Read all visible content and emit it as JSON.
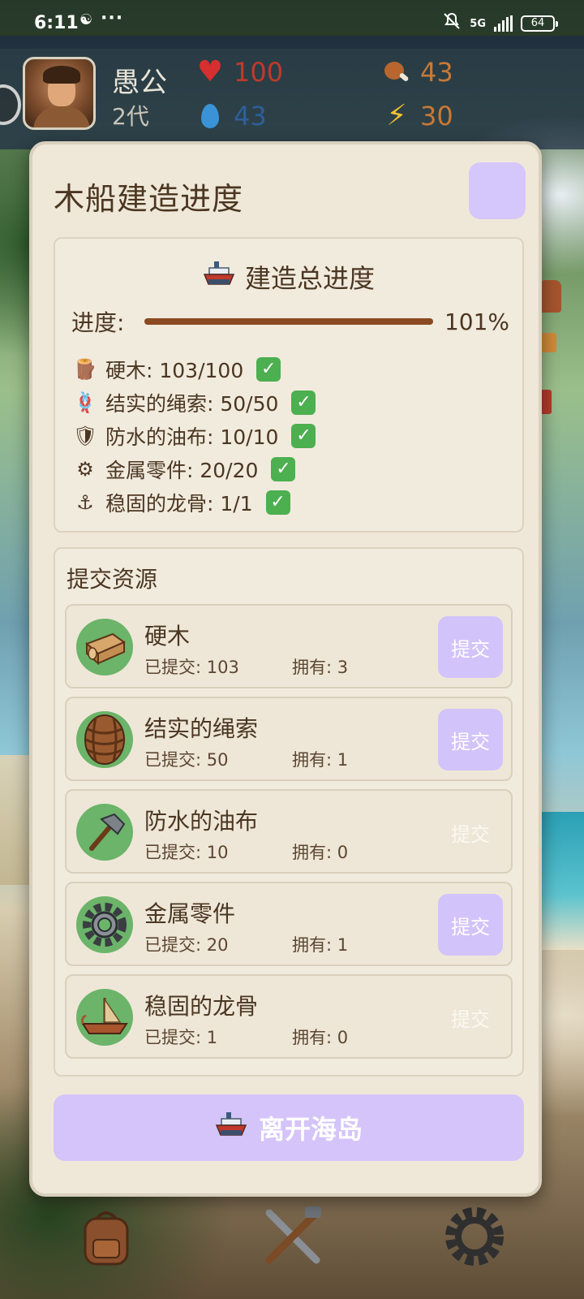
{
  "status_bar": {
    "time": "6:11",
    "notif_icon": "☯",
    "more": "···",
    "network": "5G",
    "battery": "64"
  },
  "player": {
    "name": "愚公",
    "generation": "2代",
    "hp": "100",
    "water": "43",
    "food": "43",
    "energy": "30"
  },
  "modal": {
    "title": "木船建造进度",
    "overall": {
      "title": "建造总进度",
      "label": "进度:",
      "percent_text": "101%",
      "fill_fraction": 1.0
    },
    "requirements": [
      {
        "icon": "log-icon",
        "glyph": "🪵",
        "text": "硬木: 103/100"
      },
      {
        "icon": "rope-icon",
        "glyph": "🪢",
        "text": "结实的绳索: 50/50"
      },
      {
        "icon": "shield-icon",
        "glyph": "🛡",
        "text": "防水的油布: 10/10"
      },
      {
        "icon": "gear-icon",
        "glyph": "⚙",
        "text": "金属零件: 20/20"
      },
      {
        "icon": "anchor-icon",
        "glyph": "⚓",
        "text": "稳固的龙骨: 1/1"
      }
    ],
    "submit_section": {
      "title": "提交资源",
      "items": [
        {
          "name": "硬木",
          "submitted": "已提交: 103",
          "owned": "拥有: 3",
          "button": "提交",
          "enabled": true,
          "icon": "wood-icon"
        },
        {
          "name": "结实的绳索",
          "submitted": "已提交: 50",
          "owned": "拥有: 1",
          "button": "提交",
          "enabled": true,
          "icon": "rope-icon"
        },
        {
          "name": "防水的油布",
          "submitted": "已提交: 10",
          "owned": "拥有: 0",
          "button": "提交",
          "enabled": false,
          "icon": "hammer-icon"
        },
        {
          "name": "金属零件",
          "submitted": "已提交: 20",
          "owned": "拥有: 1",
          "button": "提交",
          "enabled": true,
          "icon": "gear-icon"
        },
        {
          "name": "稳固的龙骨",
          "submitted": "已提交: 1",
          "owned": "拥有: 0",
          "button": "提交",
          "enabled": false,
          "icon": "boat-icon"
        }
      ]
    },
    "leave_button": "离开海岛"
  },
  "colors": {
    "accent": "#d4c4f9",
    "progress_fill": "#8b4a21",
    "text": "#4b3621",
    "check": "#4caf50"
  }
}
